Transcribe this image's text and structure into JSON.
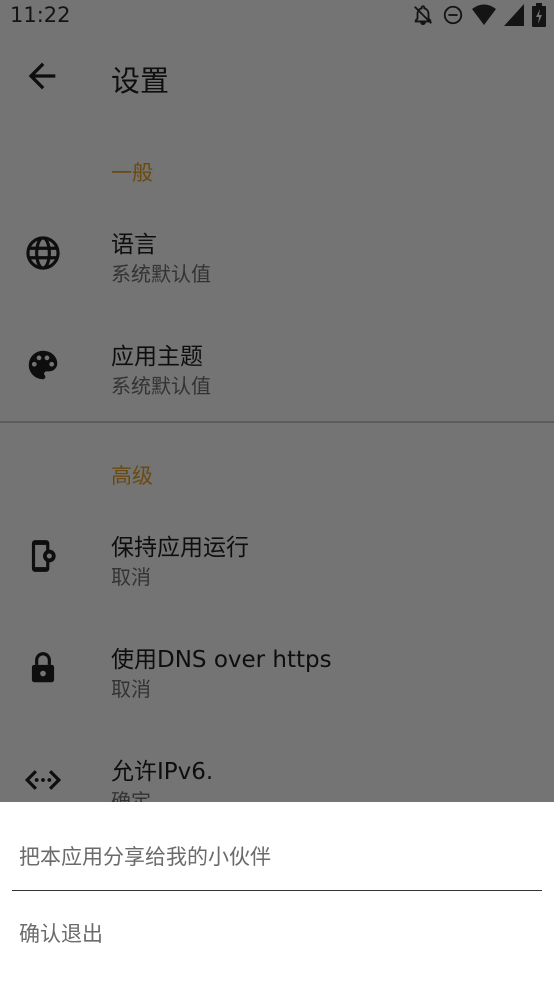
{
  "status_bar": {
    "time": "11:22",
    "icons": [
      "notifications-off-icon",
      "do-not-disturb-icon",
      "wifi-icon",
      "cell-signal-icon",
      "battery-charging-icon"
    ]
  },
  "app_bar": {
    "title": "设置",
    "back_icon": "arrow-back-icon"
  },
  "settings": {
    "general_header": "一般",
    "language": {
      "title": "语言",
      "value": "系统默认值",
      "icon": "globe-icon"
    },
    "theme": {
      "title": "应用主题",
      "value": "系统默认值",
      "icon": "palette-icon"
    },
    "advanced_header": "高级",
    "keep_running": {
      "title": "保持应用运行",
      "value": "取消",
      "icon": "phone-settings-icon"
    },
    "dns_https": {
      "title": "使用DNS over https",
      "value": "取消",
      "icon": "lock-icon"
    },
    "ipv6": {
      "title": "允许IPv6.",
      "value": "确定",
      "icon": "settings-ethernet-icon"
    }
  },
  "bottom_sheet": {
    "share": "把本应用分享给我的小伙伴",
    "exit": "确认退出"
  },
  "colors": {
    "scrim_background": "#747474",
    "section_header": "#6a4a10",
    "sheet_background": "#ffffff"
  }
}
